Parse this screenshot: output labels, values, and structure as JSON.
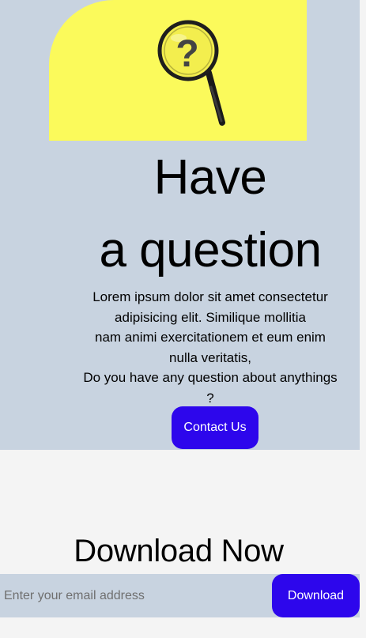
{
  "hero": {
    "image_icon": "magnifying-glass-question-icon",
    "image_glyph": "?",
    "title_line1": "Have",
    "title_line2": "a question",
    "description_lines": [
      "Lorem ipsum dolor sit amet consectetur",
      "adipisicing elit. Similique mollitia",
      "nam animi exercitationem et eum enim",
      "nulla veritatis,",
      "Do you have any question about anythings",
      "?"
    ],
    "contact_button_label": "Contact Us"
  },
  "download": {
    "title": "Download Now",
    "email_placeholder": "Enter your email address",
    "button_label": "Download"
  },
  "colors": {
    "hero_background": "#c8d3e0",
    "image_background": "#fbfa5b",
    "button_background": "#2d06ec",
    "page_background": "#f4f4f4"
  }
}
